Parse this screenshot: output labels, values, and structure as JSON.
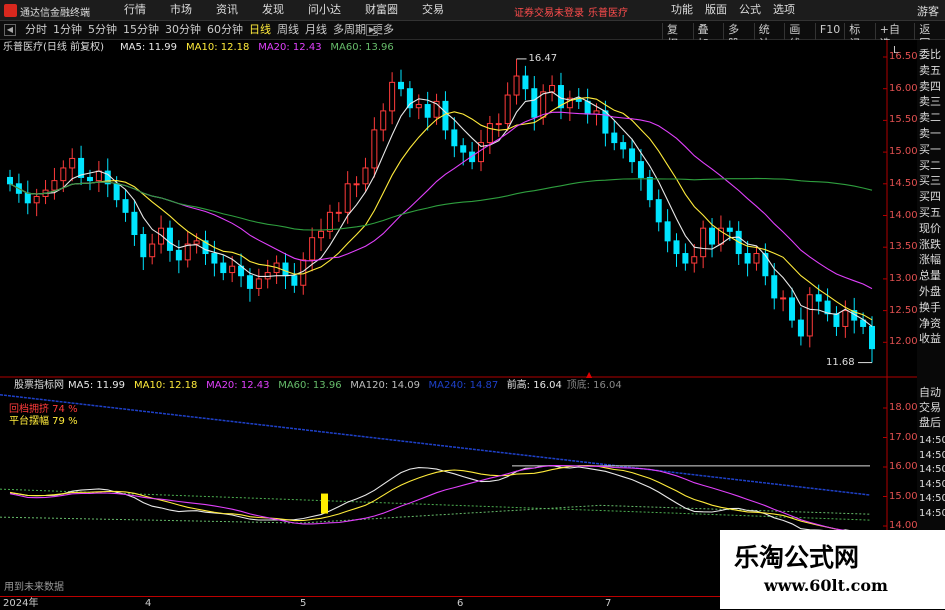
{
  "app": {
    "name": "通达信金融终端",
    "login_warning": "证券交易未登录",
    "stock_title": "乐普医疗",
    "guest": "游客"
  },
  "menu": [
    "行情",
    "市场",
    "资讯",
    "发现",
    "问小达",
    "财富圈",
    "交易"
  ],
  "right_menu": [
    "功能",
    "版面",
    "公式",
    "选项"
  ],
  "periods": [
    "分时",
    "1分钟",
    "5分钟",
    "15分钟",
    "30分钟",
    "60分钟",
    "日线",
    "周线",
    "月线",
    "多周期",
    "更多"
  ],
  "active_period": "日线",
  "tools": [
    "复权",
    "叠加",
    "多股",
    "统计",
    "画线",
    "F10",
    "标记",
    "+自选",
    "返回"
  ],
  "main_panel": {
    "title": "乐普医疗(日线 前复权)",
    "ma_labels": [
      {
        "text": "MA5: 11.99",
        "color": "#e8e8e8"
      },
      {
        "text": "MA10: 12.18",
        "color": "#ffeb3b"
      },
      {
        "text": "MA20: 12.43",
        "color": "#e040fb"
      },
      {
        "text": "MA60: 13.96",
        "color": "#66bb6a"
      }
    ],
    "high_label": "16.47",
    "low_label": "11.68",
    "price_axis": [
      "16.50",
      "16.00",
      "15.50",
      "15.00",
      "14.50",
      "14.00",
      "13.50",
      "13.00",
      "12.50",
      "12.00"
    ],
    "scale_mark": "L"
  },
  "sub_panel": {
    "title": "股票指标网",
    "ma_labels": [
      {
        "text": "MA5: 11.99",
        "color": "#e8e8e8"
      },
      {
        "text": "MA10: 12.18",
        "color": "#ffeb3b"
      },
      {
        "text": "MA20: 12.43",
        "color": "#e040fb"
      },
      {
        "text": "MA60: 13.96",
        "color": "#66bb6a"
      },
      {
        "text": "MA120: 14.09",
        "color": "#bdbdbd"
      },
      {
        "text": "MA240: 14.87",
        "color": "#1e40c8"
      },
      {
        "text": "前高: 16.04",
        "color": "#e8e8e8"
      },
      {
        "text": "顶底: 16.04",
        "color": "#888888"
      }
    ],
    "upper_text": "回档拥挤 74 %",
    "lower_text": "平台摆幅 79 %",
    "price_axis": [
      "18.00",
      "17.00",
      "16.00",
      "15.00",
      "14.00"
    ],
    "bottom_note": "用到未来数据"
  },
  "time_axis": [
    "2024年",
    "4",
    "5",
    "6",
    "7"
  ],
  "order_book": [
    "委比",
    "卖五",
    "卖四",
    "卖三",
    "卖二",
    "卖一",
    "买一",
    "买二",
    "买三",
    "买四",
    "买五",
    "现价",
    "涨跌",
    "涨幅",
    "总量",
    "外盘",
    "换手",
    "净资",
    "收益"
  ],
  "sub_right_panel": [
    "自动",
    "交易",
    "盘后",
    "14:50",
    "14:50",
    "14:50",
    "14:50",
    "14:50",
    "14:50"
  ],
  "watermark": {
    "title": "乐淘公式网",
    "url": "www.60lt.com"
  },
  "colors": {
    "up": "#ff3b3b",
    "down": "#00e5ff",
    "ma5": "#e8e8e8",
    "ma10": "#ffeb3b",
    "ma20": "#e040fb",
    "ma60": "#2e9e3e",
    "ma240": "#1e40c8",
    "axis": "#b00000"
  },
  "chart_data": {
    "type": "candlestick",
    "price_range": [
      11.7,
      16.7
    ],
    "closes": [
      14.5,
      14.35,
      14.2,
      14.3,
      14.4,
      14.55,
      14.75,
      14.9,
      14.6,
      14.55,
      14.7,
      14.5,
      14.25,
      14.05,
      13.7,
      13.35,
      13.55,
      13.8,
      13.45,
      13.3,
      13.55,
      13.6,
      13.4,
      13.25,
      13.1,
      13.2,
      13.05,
      12.85,
      13.0,
      13.1,
      13.25,
      13.05,
      12.9,
      13.3,
      13.65,
      13.75,
      14.05,
      14.05,
      14.5,
      14.5,
      14.75,
      15.35,
      15.65,
      16.1,
      16.0,
      15.7,
      15.75,
      15.55,
      15.8,
      15.35,
      15.1,
      15.0,
      14.85,
      15.15,
      15.45,
      15.45,
      15.9,
      16.2,
      16.0,
      15.55,
      15.95,
      16.05,
      15.7,
      15.85,
      15.8,
      15.6,
      15.65,
      15.3,
      15.15,
      15.05,
      14.85,
      14.6,
      14.25,
      13.9,
      13.6,
      13.4,
      13.25,
      13.35,
      13.8,
      13.55,
      13.8,
      13.75,
      13.4,
      13.25,
      13.4,
      13.05,
      12.7,
      12.7,
      12.35,
      12.1,
      12.75,
      12.65,
      12.45,
      12.25,
      12.5,
      12.35,
      12.25,
      11.9
    ],
    "high_point": 16.47,
    "low_point": 11.68
  }
}
